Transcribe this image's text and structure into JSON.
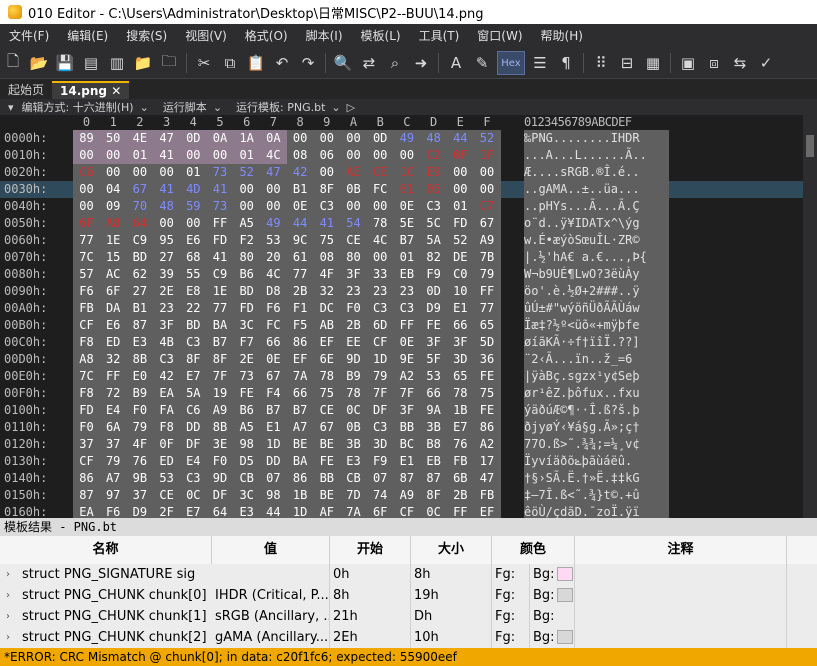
{
  "window": {
    "title": "010 Editor - C:\\Users\\Administrator\\Desktop\\日常MISC\\P2--BUU\\14.png"
  },
  "menu": [
    "文件(F)",
    "编辑(E)",
    "搜索(S)",
    "视图(V)",
    "格式(O)",
    "脚本(I)",
    "模板(L)",
    "工具(T)",
    "窗口(W)",
    "帮助(H)"
  ],
  "toolbar": {
    "hex_label": "Hex"
  },
  "tabs": [
    {
      "label": "起始页"
    },
    {
      "label": "14.png"
    }
  ],
  "subbar": {
    "edit_mode": "编辑方式: 十六进制(H)",
    "run_script": "运行脚本",
    "run_template": "运行模板: PNG.bt"
  },
  "hex": {
    "col_labels": [
      "0",
      "1",
      "2",
      "3",
      "4",
      "5",
      "6",
      "7",
      "8",
      "9",
      "A",
      "B",
      "C",
      "D",
      "E",
      "F"
    ],
    "ascii_header": "0123456789ABCDEF",
    "rows": [
      {
        "addr": "0000h:",
        "bytes": [
          "89",
          "50",
          "4E",
          "47",
          "0D",
          "0A",
          "1A",
          "0A",
          "00",
          "00",
          "00",
          "0D",
          "49",
          "48",
          "44",
          "52"
        ],
        "ascii": "‰PNG........IHDR"
      },
      {
        "addr": "0010h:",
        "bytes": [
          "00",
          "00",
          "01",
          "41",
          "00",
          "00",
          "01",
          "4C",
          "08",
          "06",
          "00",
          "00",
          "00",
          "C2",
          "0F",
          "1F"
        ],
        "ascii": "...A...L......Ã.."
      },
      {
        "addr": "0020h:",
        "bytes": [
          "C6",
          "00",
          "00",
          "00",
          "01",
          "73",
          "52",
          "47",
          "42",
          "00",
          "AE",
          "CE",
          "1C",
          "E9",
          "00",
          "00"
        ],
        "ascii": "Æ....sRGB.®Î.é.."
      },
      {
        "addr": "0030h:",
        "bytes": [
          "00",
          "04",
          "67",
          "41",
          "4D",
          "41",
          "00",
          "00",
          "B1",
          "8F",
          "0B",
          "FC",
          "61",
          "05",
          "00",
          "00"
        ],
        "ascii": "..gAMA..±..üa..."
      },
      {
        "addr": "0040h:",
        "bytes": [
          "00",
          "09",
          "70",
          "48",
          "59",
          "73",
          "00",
          "00",
          "0E",
          "C3",
          "00",
          "00",
          "0E",
          "C3",
          "01",
          "C7"
        ],
        "ascii": "..pHYs...Ã...Ã.Ç"
      },
      {
        "addr": "0050h:",
        "bytes": [
          "6F",
          "A8",
          "64",
          "00",
          "00",
          "FF",
          "A5",
          "49",
          "44",
          "41",
          "54",
          "78",
          "5E",
          "5C",
          "FD",
          "67"
        ],
        "ascii": "o¨d..ÿ¥IDATx^\\ýg"
      },
      {
        "addr": "0060h:",
        "bytes": [
          "77",
          "1E",
          "C9",
          "95",
          "E6",
          "FD",
          "F2",
          "53",
          "9C",
          "75",
          "CE",
          "4C",
          "B7",
          "5A",
          "52",
          "A9"
        ],
        "ascii": "w.É•æýòSœuÎL·ZR©"
      },
      {
        "addr": "0070h:",
        "bytes": [
          "7C",
          "15",
          "BD",
          "27",
          "68",
          "41",
          "80",
          "20",
          "61",
          "08",
          "80",
          "00",
          "01",
          "82",
          "DE",
          "7B"
        ],
        "ascii": "|.½'hA€ a.€...‚Þ{"
      },
      {
        "addr": "0080h:",
        "bytes": [
          "57",
          "AC",
          "62",
          "39",
          "55",
          "C9",
          "B6",
          "4C",
          "77",
          "4F",
          "3F",
          "33",
          "EB",
          "F9",
          "C0",
          "79"
        ],
        "ascii": "W¬b9UÉ¶LwO?3ëùÀy"
      },
      {
        "addr": "0090h:",
        "bytes": [
          "F6",
          "6F",
          "27",
          "2E",
          "E8",
          "1E",
          "BD",
          "D8",
          "2B",
          "32",
          "23",
          "23",
          "23",
          "0D",
          "10",
          "FF"
        ],
        "ascii": "öo'.è.½Ø+2###..ÿ"
      },
      {
        "addr": "00A0h:",
        "bytes": [
          "FB",
          "DA",
          "B1",
          "23",
          "22",
          "77",
          "FD",
          "F6",
          "F1",
          "DC",
          "F0",
          "C3",
          "C3",
          "D9",
          "E1",
          "77"
        ],
        "ascii": "ûÚ±#\"wýöñÜðÃÃÙáw"
      },
      {
        "addr": "00B0h:",
        "bytes": [
          "CF",
          "E6",
          "87",
          "3F",
          "BD",
          "BA",
          "3C",
          "FC",
          "F5",
          "AB",
          "2B",
          "6D",
          "FF",
          "FE",
          "66",
          "65"
        ],
        "ascii": "Ïæ‡?½º<üõ«+mÿþfe"
      },
      {
        "addr": "00C0h:",
        "bytes": [
          "F8",
          "ED",
          "E3",
          "4B",
          "C3",
          "B7",
          "F7",
          "66",
          "86",
          "EF",
          "EE",
          "CF",
          "0E",
          "3F",
          "3F",
          "5D"
        ],
        "ascii": "øíãKÃ·÷f†ïîÏ.??]"
      },
      {
        "addr": "00D0h:",
        "bytes": [
          "A8",
          "32",
          "8B",
          "C3",
          "8F",
          "8F",
          "2E",
          "0E",
          "EF",
          "6E",
          "9D",
          "1D",
          "9E",
          "5F",
          "3D",
          "36"
        ],
        "ascii": "¨2‹Ã...ïn..ž_=6"
      },
      {
        "addr": "00E0h:",
        "bytes": [
          "7C",
          "FF",
          "E0",
          "42",
          "E7",
          "7F",
          "73",
          "67",
          "7A",
          "78",
          "B9",
          "79",
          "A2",
          "53",
          "65",
          "FE"
        ],
        "ascii": "|ÿàBç.sgzx¹y¢Seþ"
      },
      {
        "addr": "00F0h:",
        "bytes": [
          "F8",
          "72",
          "B9",
          "EA",
          "5A",
          "19",
          "FE",
          "F4",
          "66",
          "75",
          "78",
          "7F",
          "7F",
          "66",
          "78",
          "75"
        ],
        "ascii": "ør¹êZ.þôfux..fxu"
      },
      {
        "addr": "0100h:",
        "bytes": [
          "FD",
          "E4",
          "F0",
          "FA",
          "C6",
          "A9",
          "B6",
          "B7",
          "B7",
          "CE",
          "0C",
          "DF",
          "3F",
          "9A",
          "1B",
          "FE"
        ],
        "ascii": "ýäðúÆ©¶··Î.ß?š.þ"
      },
      {
        "addr": "0110h:",
        "bytes": [
          "F0",
          "6A",
          "79",
          "F8",
          "DD",
          "8B",
          "A5",
          "E1",
          "A7",
          "67",
          "0B",
          "C3",
          "BB",
          "3B",
          "E7",
          "86"
        ],
        "ascii": "ðjyøÝ‹¥á§g.Ã»;ç†"
      },
      {
        "addr": "0120h:",
        "bytes": [
          "37",
          "37",
          "4F",
          "0F",
          "DF",
          "3E",
          "98",
          "1D",
          "BE",
          "BE",
          "3B",
          "3D",
          "BC",
          "B8",
          "76",
          "A2"
        ],
        "ascii": "77O.ß>˜.¾¾;=¼¸v¢"
      },
      {
        "addr": "0130h:",
        "bytes": [
          "CF",
          "79",
          "76",
          "ED",
          "E4",
          "F0",
          "D5",
          "DD",
          "BA",
          "FE",
          "E3",
          "F9",
          "E1",
          "EB",
          "FB",
          "17"
        ],
        "ascii": "Ïyvíäðõݺþãùáëû."
      },
      {
        "addr": "0140h:",
        "bytes": [
          "86",
          "A7",
          "9B",
          "53",
          "C3",
          "9D",
          "CB",
          "07",
          "86",
          "BB",
          "CB",
          "07",
          "87",
          "87",
          "6B",
          "47"
        ],
        "ascii": "†§›SÃ.Ë.†»Ë.‡‡kG"
      },
      {
        "addr": "0150h:",
        "bytes": [
          "87",
          "97",
          "37",
          "CE",
          "0C",
          "DF",
          "3C",
          "98",
          "1B",
          "BE",
          "7D",
          "74",
          "A9",
          "8F",
          "2B",
          "FB"
        ],
        "ascii": "‡—7Î.ß<˜.¾}t©.+û"
      },
      {
        "addr": "0160h:",
        "bytes": [
          "EA",
          "F6",
          "D9",
          "2F",
          "E7",
          "64",
          "E3",
          "44",
          "1D",
          "AF",
          "7A",
          "6F",
          "CF",
          "0C",
          "FF",
          "EF"
        ],
        "ascii": "êöÙ/çdãD.¯zoÏ.ÿï"
      }
    ]
  },
  "template_panel": {
    "title": "模板结果 - PNG.bt",
    "columns": [
      "名称",
      "值",
      "开始",
      "大小",
      "颜色",
      "注释"
    ],
    "rows": [
      {
        "name": "struct PNG_SIGNATURE sig",
        "value": "",
        "start": "0h",
        "size": "8h",
        "fg": "Fg:",
        "bg": "Bg:",
        "swatch": "#ffd8f4"
      },
      {
        "name": "struct PNG_CHUNK chunk[0]",
        "value": "IHDR  (Critical, P...",
        "start": "8h",
        "size": "19h",
        "fg": "Fg:",
        "bg": "Bg:",
        "swatch": "#d8d8d8"
      },
      {
        "name": "struct PNG_CHUNK chunk[1]",
        "value": "sRGB  (Ancillary, ...",
        "start": "21h",
        "size": "Dh",
        "fg": "Fg:",
        "bg": "Bg:",
        "swatch": ""
      },
      {
        "name": "struct PNG_CHUNK chunk[2]",
        "value": "gAMA  (Ancillary...",
        "start": "2Eh",
        "size": "10h",
        "fg": "Fg:",
        "bg": "Bg:",
        "swatch": "#d8d8d8"
      }
    ]
  },
  "status": {
    "text": "*ERROR: CRC Mismatch @ chunk[0]; in data: c20f1fc6; expected: 55900eef"
  }
}
